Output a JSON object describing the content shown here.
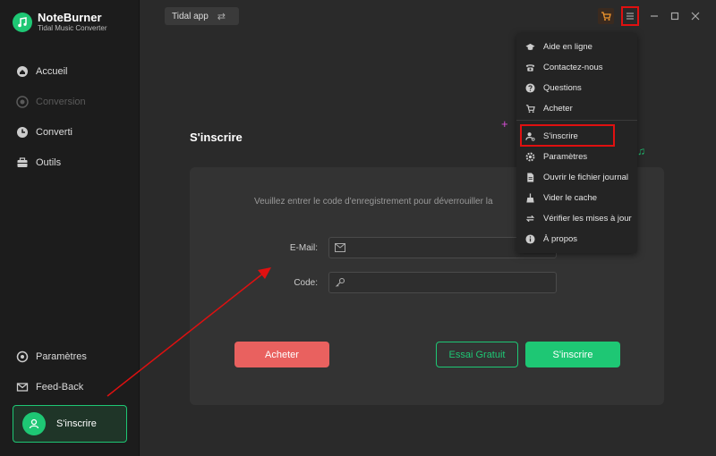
{
  "brand": {
    "name": "NoteBurner",
    "subtitle": "Tidal Music Converter"
  },
  "sidebar": {
    "items": [
      {
        "label": "Accueil",
        "icon": "home-icon",
        "disabled": false
      },
      {
        "label": "Conversion",
        "icon": "conversion-icon",
        "disabled": true
      },
      {
        "label": "Converti",
        "icon": "clock-icon",
        "disabled": false
      },
      {
        "label": "Outils",
        "icon": "toolbox-icon",
        "disabled": false
      }
    ],
    "bottom_items": [
      {
        "label": "Paramètres",
        "icon": "gear-icon"
      },
      {
        "label": "Feed-Back",
        "icon": "mail-icon"
      }
    ],
    "register_label": "S'inscrire"
  },
  "topbar": {
    "source_label": "Tidal app"
  },
  "main": {
    "title": "S'inscrire",
    "hint": "Veuillez entrer le code d'enregistrement pour déverrouiller la",
    "email_label": "E-Mail:",
    "code_label": "Code:",
    "buy_label": "Acheter",
    "trial_label": "Essai Gratuit",
    "register_label": "S'inscrire"
  },
  "menu": {
    "items": [
      {
        "label": "Aide en ligne",
        "icon": "graduation-cap-icon"
      },
      {
        "label": "Contactez-nous",
        "icon": "phone-icon"
      },
      {
        "label": "Questions",
        "icon": "question-icon"
      },
      {
        "label": "Acheter",
        "icon": "cart-icon"
      },
      {
        "label": "S'inscrire",
        "icon": "user-key-icon"
      },
      {
        "label": "Paramètres",
        "icon": "gear-icon"
      },
      {
        "label": "Ouvrir le fichier journal",
        "icon": "file-icon"
      },
      {
        "label": "Vider le cache",
        "icon": "broom-icon"
      },
      {
        "label": "Vérifier les mises à jour",
        "icon": "refresh-icon"
      },
      {
        "label": "À propos",
        "icon": "info-icon"
      }
    ]
  },
  "colors": {
    "accent": "#1ec774",
    "buy": "#e9615f",
    "annotation": "#e01010"
  }
}
